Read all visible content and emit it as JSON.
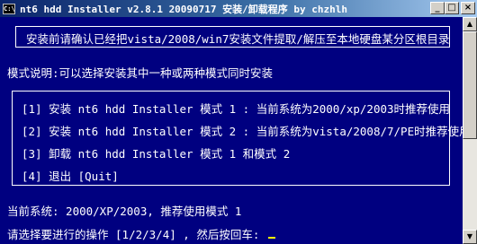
{
  "window": {
    "icon_text": "C:\\",
    "title": "nt6 hdd Installer v2.8.1 20090717 安装/卸载程序 by chzhlh",
    "min_glyph": "_",
    "max_glyph": "□",
    "close_glyph": "×"
  },
  "console": {
    "header_box_text": "安装前请确认已经把vista/2008/win7安装文件提取/解压至本地硬盘某分区根目录",
    "mode_note": "模式说明:可以选择安装其中一种或两种模式同时安装",
    "menu": [
      "[1] 安装 nt6 hdd Installer 模式 1 : 当前系统为2000/xp/2003时推荐使用",
      "[2] 安装 nt6 hdd Installer 模式 2 : 当前系统为vista/2008/7/PE时推荐使用",
      "[3] 卸载 nt6 hdd Installer 模式 1 和模式 2",
      "[4] 退出 [Quit]"
    ],
    "current_system": "当前系统: 2000/XP/2003, 推荐使用模式 1",
    "prompt": "请选择要进行的操作 [1/2/3/4] , 然后按回车: "
  },
  "scrollbar": {
    "up_glyph": "▲",
    "down_glyph": "▼"
  },
  "colors": {
    "console_bg": "#000080",
    "console_fg": "#ffffff",
    "cursor": "#ffff00"
  }
}
